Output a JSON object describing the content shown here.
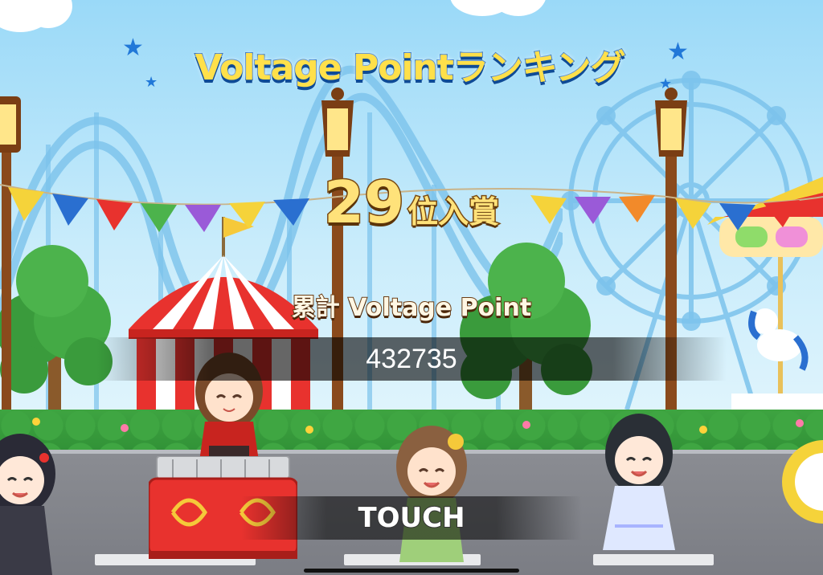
{
  "screen": {
    "title": "Voltage Pointランキング",
    "rank": {
      "number": "29",
      "suffix": "位入賞"
    },
    "cumulative_label": "累計 Voltage Point",
    "cumulative_value": "432735",
    "touch_prompt": "TOUCH"
  },
  "icons": {
    "title_stars": "star-icon"
  },
  "colors": {
    "title_fill": "#ffe04a",
    "title_outline": "#1c62b8",
    "rank_fill": "#ffe27a",
    "rank_outline": "#7a4a12",
    "score_band": "#000000"
  }
}
